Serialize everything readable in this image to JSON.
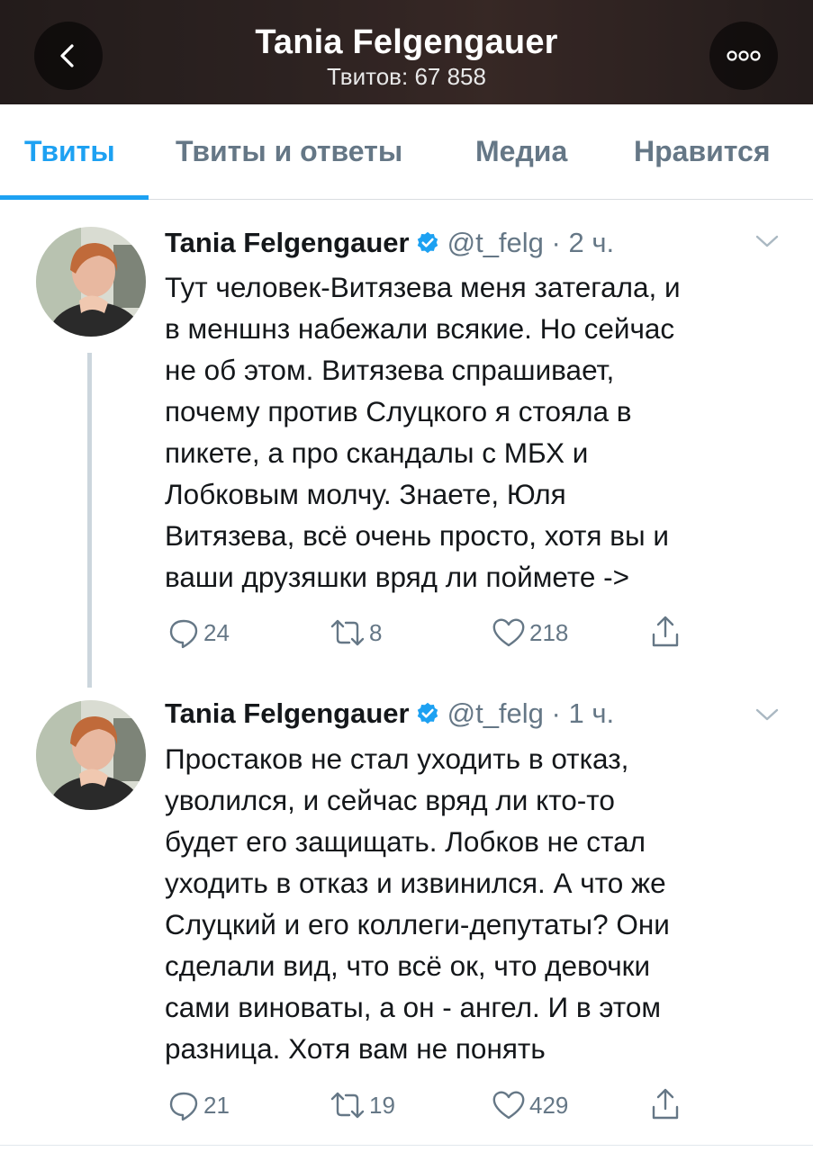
{
  "header": {
    "title": "Tania Felgengauer",
    "subtitle": "Твитов: 67 858",
    "back_icon": "chevron-left-icon",
    "more_icon": "more-dots-icon"
  },
  "tabs": [
    {
      "label": "Твиты",
      "active": true
    },
    {
      "label": "Твиты и ответы",
      "active": false
    },
    {
      "label": "Медиа",
      "active": false
    },
    {
      "label": "Нравится",
      "active": false
    }
  ],
  "colors": {
    "accent": "#1da1f2",
    "secondary_text": "#657786",
    "primary_text": "#14171a"
  },
  "tweets": [
    {
      "name": "Tania Felgengauer",
      "handle": "@t_felg",
      "separator": "·",
      "time": "2 ч.",
      "lines": [
        "Тут человек-Витязева меня затегала, и",
        "в меншнз набежали всякие. Но сейчас",
        "не об этом. Витязева спрашивает,",
        "почему против Слуцкого я стояла в",
        "пикете, а про скандалы с МБХ и",
        "Лобковым молчу. Знаете, Юля",
        "Витязева, всё очень просто, хотя вы и",
        "ваши друзяшки вряд ли поймете ->"
      ],
      "replies": "24",
      "retweets": "8",
      "likes": "218"
    },
    {
      "name": "Tania Felgengauer",
      "handle": "@t_felg",
      "separator": "·",
      "time": "1 ч.",
      "lines": [
        "Простаков не стал уходить в отказ,",
        "уволился, и сейчас вряд ли кто-то",
        "будет его защищать. Лобков не стал",
        "уходить в отказ и извинился. А что же",
        "Слуцкий и его коллеги-депутаты? Они",
        "сделали вид, что всё ок, что девочки",
        "сами виноваты, а он - ангел. И в этом",
        "разница. Хотя вам не понять"
      ],
      "replies": "21",
      "retweets": "19",
      "likes": "429"
    }
  ]
}
